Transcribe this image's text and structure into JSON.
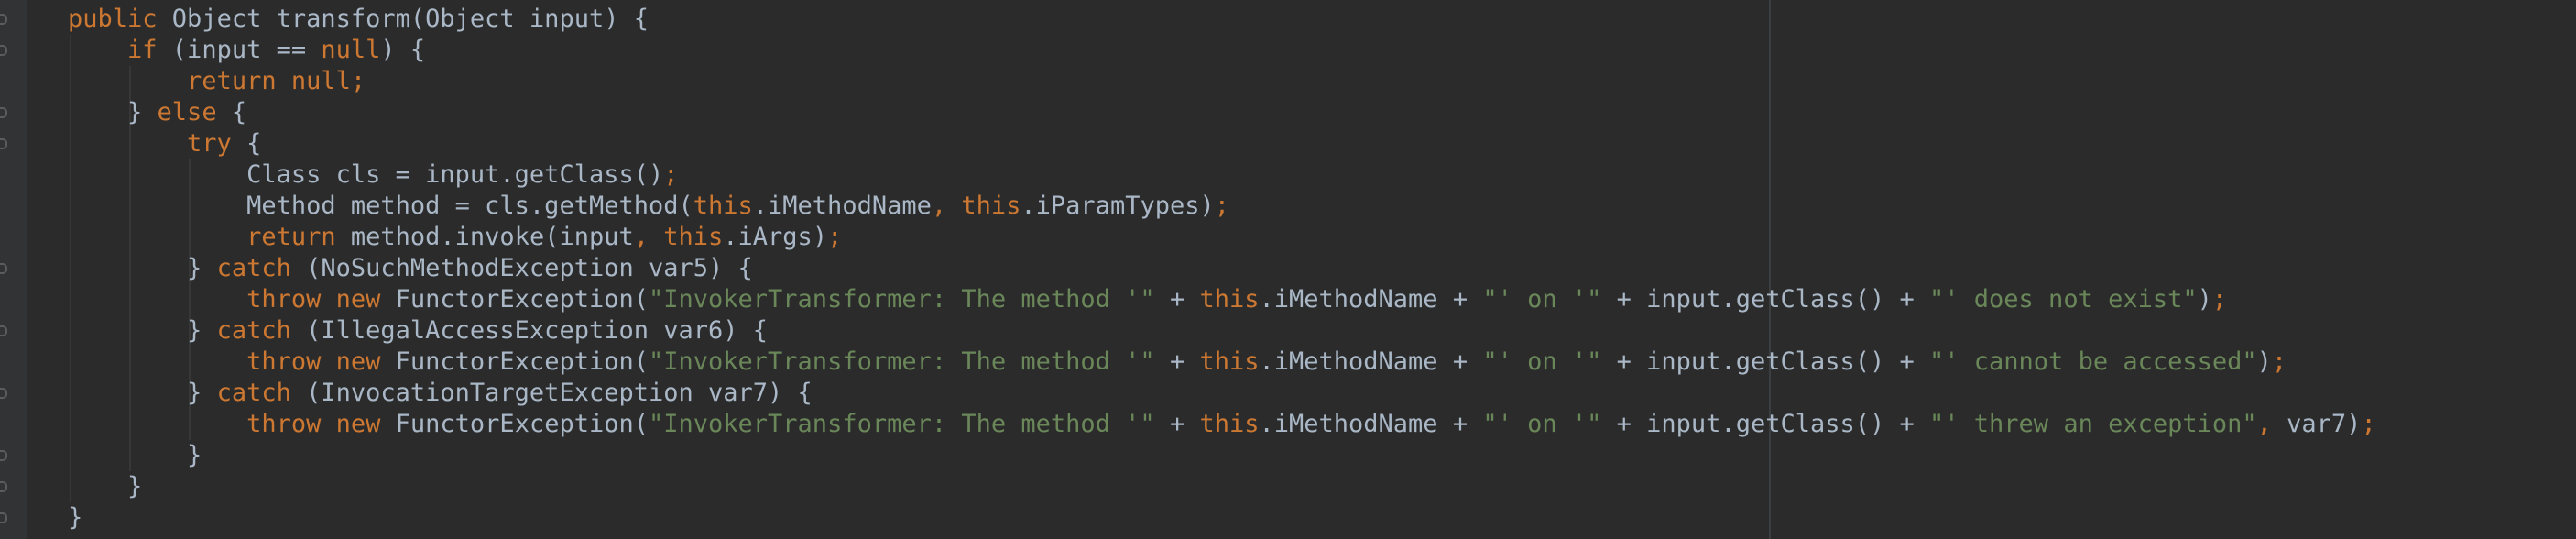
{
  "editor": {
    "theme": "darcula",
    "colors": {
      "background": "#2b2b2b",
      "keyword": "#cc7832",
      "string": "#6a8759",
      "text": "#a9b7c6"
    },
    "lines": [
      {
        "indent": 0,
        "tokens": [
          {
            "t": "kw",
            "v": "public"
          },
          {
            "t": "txt",
            "v": " Object transform(Object input) {"
          }
        ]
      },
      {
        "indent": 1,
        "tokens": [
          {
            "t": "kw",
            "v": "if"
          },
          {
            "t": "txt",
            "v": " (input == "
          },
          {
            "t": "kw",
            "v": "null"
          },
          {
            "t": "txt",
            "v": ") {"
          }
        ]
      },
      {
        "indent": 2,
        "tokens": [
          {
            "t": "kw",
            "v": "return null;"
          }
        ]
      },
      {
        "indent": 1,
        "tokens": [
          {
            "t": "txt",
            "v": "} "
          },
          {
            "t": "kw",
            "v": "else"
          },
          {
            "t": "txt",
            "v": " {"
          }
        ]
      },
      {
        "indent": 2,
        "tokens": [
          {
            "t": "kw",
            "v": "try"
          },
          {
            "t": "txt",
            "v": " {"
          }
        ]
      },
      {
        "indent": 3,
        "tokens": [
          {
            "t": "txt",
            "v": "Class cls = input.getClass()"
          },
          {
            "t": "kw",
            "v": ";"
          }
        ]
      },
      {
        "indent": 3,
        "tokens": [
          {
            "t": "txt",
            "v": "Method method = cls.getMethod("
          },
          {
            "t": "kw",
            "v": "this"
          },
          {
            "t": "txt",
            "v": ".iMethodName"
          },
          {
            "t": "kw",
            "v": ", this"
          },
          {
            "t": "txt",
            "v": ".iParamTypes)"
          },
          {
            "t": "kw",
            "v": ";"
          }
        ]
      },
      {
        "indent": 3,
        "tokens": [
          {
            "t": "kw",
            "v": "return"
          },
          {
            "t": "txt",
            "v": " method.invoke(input"
          },
          {
            "t": "kw",
            "v": ", this"
          },
          {
            "t": "txt",
            "v": ".iArgs)"
          },
          {
            "t": "kw",
            "v": ";"
          }
        ]
      },
      {
        "indent": 2,
        "tokens": [
          {
            "t": "txt",
            "v": "} "
          },
          {
            "t": "kw",
            "v": "catch"
          },
          {
            "t": "txt",
            "v": " (NoSuchMethodException var5) {"
          }
        ]
      },
      {
        "indent": 3,
        "tokens": [
          {
            "t": "kw",
            "v": "throw new"
          },
          {
            "t": "txt",
            "v": " FunctorException("
          },
          {
            "t": "str",
            "v": "\"InvokerTransformer: The method '\""
          },
          {
            "t": "txt",
            "v": " + "
          },
          {
            "t": "kw",
            "v": "this"
          },
          {
            "t": "txt",
            "v": ".iMethodName + "
          },
          {
            "t": "str",
            "v": "\"' on '\""
          },
          {
            "t": "txt",
            "v": " + input.getClass() + "
          },
          {
            "t": "str",
            "v": "\"' does not exist\""
          },
          {
            "t": "txt",
            "v": ")"
          },
          {
            "t": "kw",
            "v": ";"
          }
        ]
      },
      {
        "indent": 2,
        "tokens": [
          {
            "t": "txt",
            "v": "} "
          },
          {
            "t": "kw",
            "v": "catch"
          },
          {
            "t": "txt",
            "v": " (IllegalAccessException var6) {"
          }
        ]
      },
      {
        "indent": 3,
        "tokens": [
          {
            "t": "kw",
            "v": "throw new"
          },
          {
            "t": "txt",
            "v": " FunctorException("
          },
          {
            "t": "str",
            "v": "\"InvokerTransformer: The method '\""
          },
          {
            "t": "txt",
            "v": " + "
          },
          {
            "t": "kw",
            "v": "this"
          },
          {
            "t": "txt",
            "v": ".iMethodName + "
          },
          {
            "t": "str",
            "v": "\"' on '\""
          },
          {
            "t": "txt",
            "v": " + input.getClass() + "
          },
          {
            "t": "str",
            "v": "\"' cannot be accessed\""
          },
          {
            "t": "txt",
            "v": ")"
          },
          {
            "t": "kw",
            "v": ";"
          }
        ]
      },
      {
        "indent": 2,
        "tokens": [
          {
            "t": "txt",
            "v": "} "
          },
          {
            "t": "kw",
            "v": "catch"
          },
          {
            "t": "txt",
            "v": " (InvocationTargetException var7) {"
          }
        ]
      },
      {
        "indent": 3,
        "tokens": [
          {
            "t": "kw",
            "v": "throw new"
          },
          {
            "t": "txt",
            "v": " FunctorException("
          },
          {
            "t": "str",
            "v": "\"InvokerTransformer: The method '\""
          },
          {
            "t": "txt",
            "v": " + "
          },
          {
            "t": "kw",
            "v": "this"
          },
          {
            "t": "txt",
            "v": ".iMethodName + "
          },
          {
            "t": "str",
            "v": "\"' on '\""
          },
          {
            "t": "txt",
            "v": " + input.getClass() + "
          },
          {
            "t": "str",
            "v": "\"' threw an exception\""
          },
          {
            "t": "kw",
            "v": ","
          },
          {
            "t": "txt",
            "v": " var7)"
          },
          {
            "t": "kw",
            "v": ";"
          }
        ]
      },
      {
        "indent": 2,
        "tokens": [
          {
            "t": "txt",
            "v": "}"
          }
        ]
      },
      {
        "indent": 1,
        "tokens": [
          {
            "t": "txt",
            "v": "}"
          }
        ]
      },
      {
        "indent": 0,
        "tokens": [
          {
            "t": "txt",
            "v": "}"
          }
        ]
      }
    ]
  }
}
